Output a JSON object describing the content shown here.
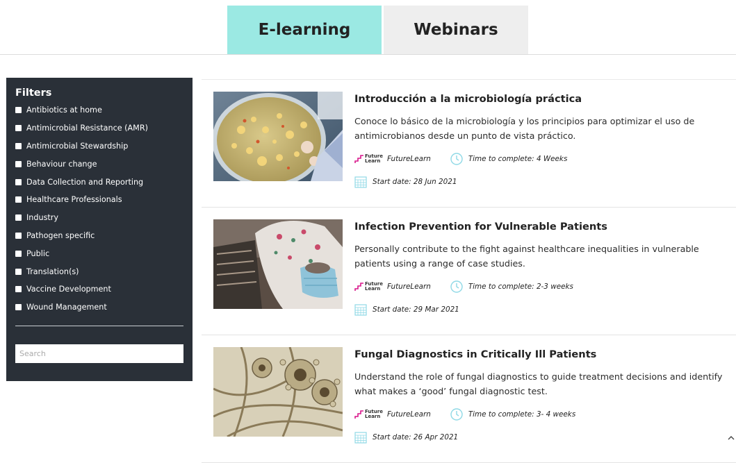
{
  "tabs": [
    {
      "label": "E-learning",
      "active": true
    },
    {
      "label": "Webinars",
      "active": false
    }
  ],
  "colors": {
    "active_tab": "#9be9e3",
    "inactive_tab": "#eeeeee",
    "sidebar": "#2a3038",
    "accent_icon": "#8fd9e6",
    "futurelearn_logo": "#d9178b"
  },
  "filters": {
    "title": "Filters",
    "items": [
      "Antibiotics at home",
      "Antimicrobial Resistance (AMR)",
      "Antimicrobial Stewardship",
      "Behaviour change",
      "Data Collection and Reporting",
      "Healthcare Professionals",
      "Industry",
      "Pathogen specific",
      "Public",
      "Translation(s)",
      "Vaccine Development",
      "Wound Management"
    ],
    "search_placeholder": "Search"
  },
  "futurelearn_logo_text": [
    "Future",
    "Learn"
  ],
  "courses": [
    {
      "title": "Introducción a la microbiología práctica",
      "description": "Conoce lo básico de la microbiología y los principios para optimizar el uso de antimicrobianos desde un punto de vista práctico.",
      "provider": "FutureLearn",
      "time": "Time to complete: 4 Weeks",
      "start": "Start date: 28 Jun 2021",
      "image": "petri-dish-photo"
    },
    {
      "title": "Infection Prevention for Vulnerable Patients",
      "description": "Personally contribute to the fight against healthcare inequalities in vulnerable patients using a range of case studies.",
      "provider": "FutureLearn",
      "time": "Time to complete: 2-3 weeks",
      "start": "Start date: 29 Mar 2021",
      "image": "masked-healthcare-worker-photo"
    },
    {
      "title": "Fungal Diagnostics in Critically Ill Patients",
      "description": "Understand the role of fungal diagnostics to guide treatment decisions and identify what makes a ‘good’ fungal diagnostic test.",
      "provider": "FutureLearn",
      "time": "Time to complete: 3- 4 weeks",
      "start": "Start date: 26 Apr 2021",
      "image": "fungal-microscopy-photo"
    }
  ],
  "icons": {
    "clock": "clock-icon",
    "calendar": "calendar-icon",
    "scroll": "chevron-up-icon"
  }
}
